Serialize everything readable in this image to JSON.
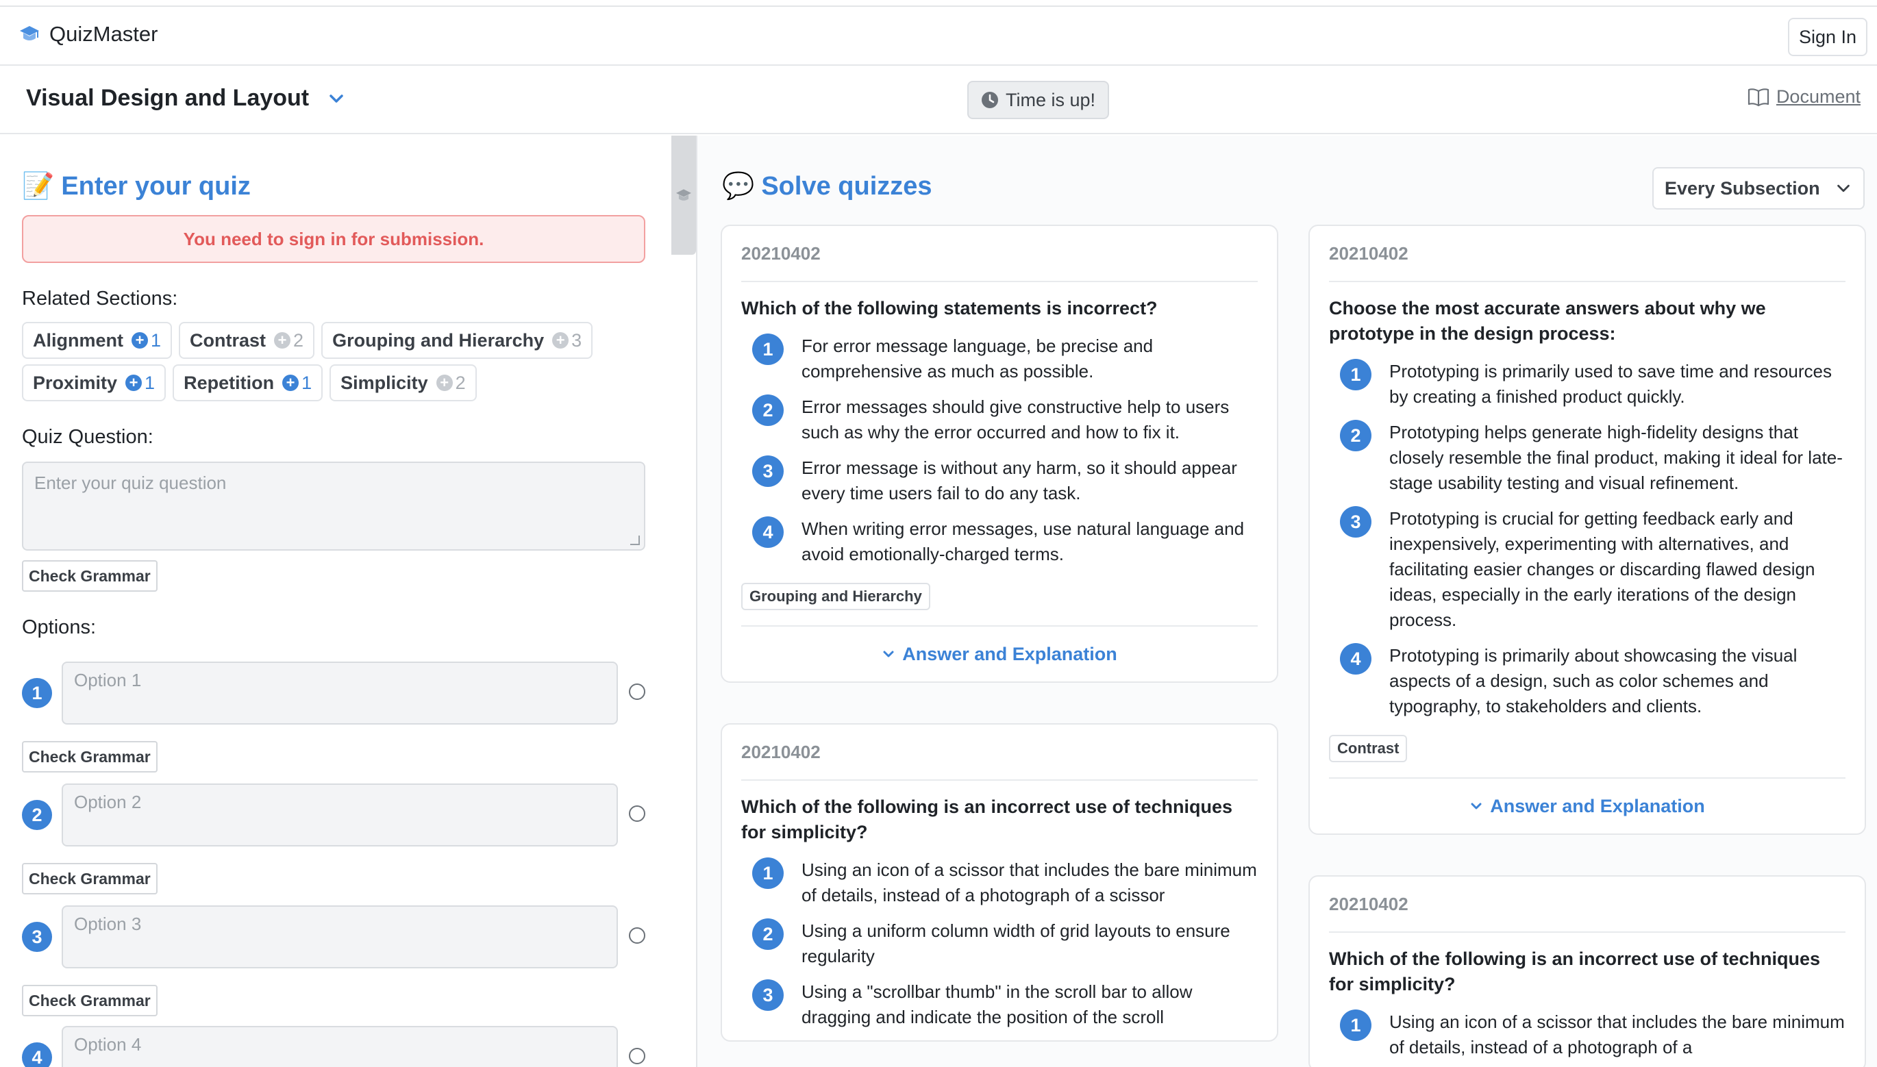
{
  "app": {
    "name": "QuizMaster",
    "sign_in": "Sign In"
  },
  "header": {
    "course_title": "Visual Design and Layout",
    "timer": "Time is up!",
    "document_link": "Document"
  },
  "editor": {
    "title": "Enter your quiz",
    "alert": "You need to sign in for submission.",
    "related_label": "Related Sections:",
    "sections": [
      {
        "name": "Alignment",
        "count": "1",
        "active": true
      },
      {
        "name": "Contrast",
        "count": "2",
        "active": false
      },
      {
        "name": "Grouping and Hierarchy",
        "count": "3",
        "active": false
      },
      {
        "name": "Proximity",
        "count": "1",
        "active": true
      },
      {
        "name": "Repetition",
        "count": "1",
        "active": true
      },
      {
        "name": "Simplicity",
        "count": "2",
        "active": false
      }
    ],
    "question_label": "Quiz Question:",
    "question_placeholder": "Enter your quiz question",
    "check_grammar": "Check Grammar",
    "options_label": "Options:",
    "options": [
      {
        "num": "1",
        "placeholder": "Option 1"
      },
      {
        "num": "2",
        "placeholder": "Option 2"
      },
      {
        "num": "3",
        "placeholder": "Option 3"
      },
      {
        "num": "4",
        "placeholder": "Option 4"
      }
    ]
  },
  "solver": {
    "title": "Solve quizzes",
    "filter": "Every Subsection",
    "answer_link": "Answer and Explanation",
    "cards": [
      {
        "date": "20210402",
        "question": "Which of the following statements is incorrect?",
        "answers": [
          "For error message language, be precise and comprehensive as much as possible.",
          "Error messages should give constructive help to users such as why the error occurred and how to fix it.",
          "Error message is without any harm, so it should appear every time users fail to do any task.",
          "When writing error messages, use natural language and avoid emotionally-charged terms."
        ],
        "tag": "Grouping and Hierarchy"
      },
      {
        "date": "20210402",
        "question": "Choose the most accurate answers about why we prototype in the design process:",
        "answers": [
          "Prototyping is primarily used to save time and resources by creating a finished product quickly.",
          "Prototyping helps generate high-fidelity designs that closely resemble the final product, making it ideal for late-stage usability testing and visual refinement.",
          "Prototyping is crucial for getting feedback early and inexpensively, experimenting with alternatives, and facilitating easier changes or discarding flawed design ideas, especially in the early iterations of the design process.",
          "Prototyping is primarily about showcasing the visual aspects of a design, such as color schemes and typography, to stakeholders and clients."
        ],
        "tag": "Contrast"
      },
      {
        "date": "20210402",
        "question": "Which of the following is an incorrect use of techniques for simplicity?",
        "answers": [
          "Using an icon of a scissor that includes the bare minimum of details, instead of a photograph of a scissor",
          "Using a uniform column width of grid layouts to ensure regularity",
          "Using a \"scrollbar thumb\" in the scroll bar to allow dragging and indicate the position of the scroll"
        ],
        "tag": ""
      },
      {
        "date": "20210402",
        "question": "Which of the following is an incorrect use of techniques for simplicity?",
        "answers": [
          "Using an icon of a scissor that includes the bare minimum of details, instead of a photograph of a"
        ],
        "tag": ""
      }
    ]
  },
  "colors": {
    "accent": "#3b82d6",
    "alert_bg": "#fdecec",
    "alert_text": "#e25a5a"
  }
}
